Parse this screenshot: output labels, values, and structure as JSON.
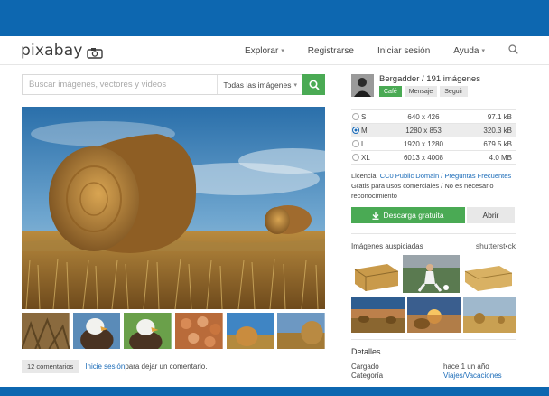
{
  "brand": {
    "logo_text": "pixabay"
  },
  "nav": {
    "explore": "Explorar",
    "register": "Registrarse",
    "login": "Iniciar sesión",
    "help": "Ayuda"
  },
  "search": {
    "placeholder": "Buscar imágenes, vectores y videos",
    "filter": "Todas las imágenes"
  },
  "author": {
    "name_line": "Bergadder / 191 imágenes",
    "buttons": [
      "Café",
      "Mensaje",
      "Seguir"
    ]
  },
  "sizes": [
    {
      "label": "S",
      "dims": "640 x 426",
      "filesize": "97.1 kB",
      "selected": false
    },
    {
      "label": "M",
      "dims": "1280 x 853",
      "filesize": "320.3 kB",
      "selected": true
    },
    {
      "label": "L",
      "dims": "1920 x 1280",
      "filesize": "679.5 kB",
      "selected": false
    },
    {
      "label": "XL",
      "dims": "6013 x 4008",
      "filesize": "4.0 MB",
      "selected": false
    }
  ],
  "license": {
    "prefix": "Licencia: ",
    "link": "CC0 Public Domain / Preguntas Frecuentes",
    "text": "Gratis para usos comerciales / No es necesario reconocimiento"
  },
  "download": {
    "label": "Descarga gratuita",
    "open_label": "Abrir"
  },
  "sponsored": {
    "label": "Imágenes auspiciadas",
    "provider": "shutterst•ck"
  },
  "details": {
    "title": "Detalles",
    "rows": [
      {
        "key": "Cargado",
        "value": "hace 1 un año"
      },
      {
        "key": "Categoría",
        "value": "Viajes/Vacaciones"
      }
    ]
  },
  "comments": {
    "count": "12 comentarios",
    "login_link": "Inicie sesión",
    "suffix": " para dejar un comentario."
  },
  "colors": {
    "brand_blue": "#0d67b0",
    "accent_green": "#4aaa54",
    "link_blue": "#1a6bb8"
  },
  "icons": {
    "search": "search-icon",
    "camera": "camera-icon",
    "download": "download-icon"
  }
}
